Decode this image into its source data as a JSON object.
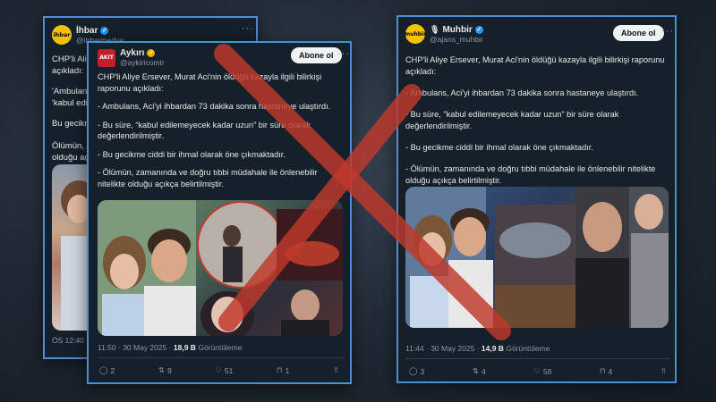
{
  "back_card": {
    "avatar_text": "ihbar",
    "name": "İhbar",
    "handle": "@ihbarmedya",
    "text_lines": [
      "CHP'li Aliye E",
      "açıkladı:",
      "'Ambulans, A",
      "'kabul edilm",
      "Bu gecikme",
      "Ölümün, zam",
      "olduğu açıkç"
    ],
    "time": "ÖS 12:40 ·"
  },
  "left_card": {
    "avatar_text": "AKIT",
    "name": "Aykırı",
    "handle": "@aykiricomtr",
    "follow_label": "Abone ol",
    "paragraphs": [
      "CHP'li Aliye Ersever, Murat Aci'nin öldüğü kazayla ilgili bilirkişi raporunu açıkladı:",
      "- Ambulans, Aci'yi ihbardan 73 dakika sonra hastaneye ulaştırdı.",
      "- Bu süre, “kabul edilemeyecek kadar uzun” bir süre olarak değerlendirilmiştir.",
      "- Bu gecikme ciddi bir ihmal olarak öne çıkmaktadır.",
      "- Ölümün, zamanında ve doğru tıbbi müdahale ile önlenebilir nitelikte olduğu açıkça belirtilmiştir."
    ],
    "time": "11:50 · 30 May 2025 ·",
    "views": "18,9 B",
    "views_label": "Görüntüleme",
    "stats": {
      "replies": "2",
      "reposts": "9",
      "likes": "51",
      "bookmarks": "1"
    }
  },
  "right_card": {
    "avatar_text": "muhbir",
    "name": "Muhbir",
    "handle": "@ajans_muhbir",
    "follow_label": "Abone ol",
    "paragraphs": [
      "CHP'li Aliye Ersever, Murat Aci'nin öldüğü kazayla ilgili bilirkişi raporunu açıkladı:",
      "- Ambulans, Aci'yi ihbardan 73 dakika sonra hastaneye ulaştırdı.",
      "- Bu süre, \"kabul edilemeyecek kadar uzun\" bir süre olarak değerlendirilmiştir.",
      "- Bu gecikme ciddi bir ihmal olarak öne çıkmaktadır.",
      "- Ölümün, zamanında ve doğru tıbbi müdahale ile önlenebilir nitelikte olduğu açıkça belirtilmiştir."
    ],
    "time": "11:44 · 30 May 2025 ·",
    "views": "14,9 B",
    "views_label": "Görüntüleme",
    "stats": {
      "replies": "3",
      "reposts": "4",
      "likes": "58",
      "bookmarks": "4"
    }
  },
  "colors": {
    "frame": "#4a8fd6",
    "cross": "#c0392b",
    "card_bg": "#15202b"
  }
}
